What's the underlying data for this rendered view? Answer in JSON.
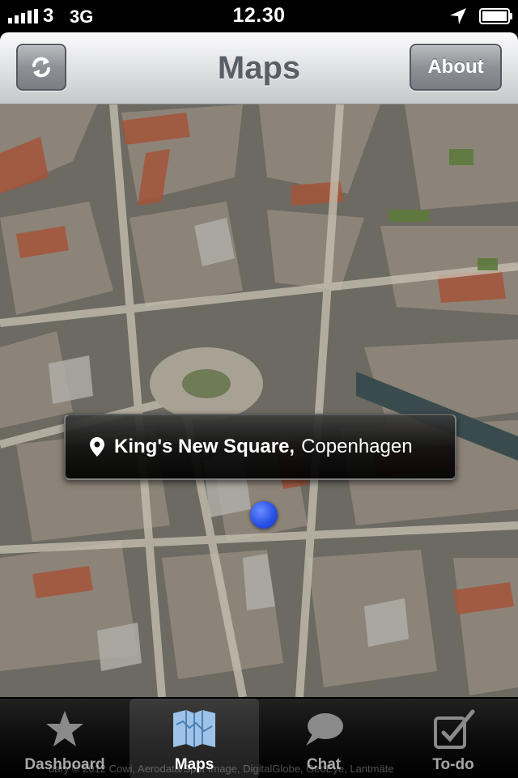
{
  "status_bar": {
    "carrier": "3",
    "network": "3G",
    "time": "12.30"
  },
  "nav": {
    "title": "Maps",
    "about_label": "About",
    "refresh_icon": "refresh-icon"
  },
  "map": {
    "callout": {
      "place": "King's New Square,",
      "city": "Copenhagen"
    },
    "copyright": "uary © 2012 Cowi, Aerodata/Spot Image, DigitalGlobe, GeoEye, Lantmäte"
  },
  "tabs": [
    {
      "label": "Dashboard",
      "icon": "star-icon",
      "active": false
    },
    {
      "label": "Maps",
      "icon": "map-icon",
      "active": true
    },
    {
      "label": "Chat",
      "icon": "chat-bubble-icon",
      "active": false
    },
    {
      "label": "To-do",
      "icon": "checkbox-icon",
      "active": false
    }
  ],
  "colors": {
    "pointer": "#2a52e6",
    "nav_title": "#5a5e66"
  }
}
